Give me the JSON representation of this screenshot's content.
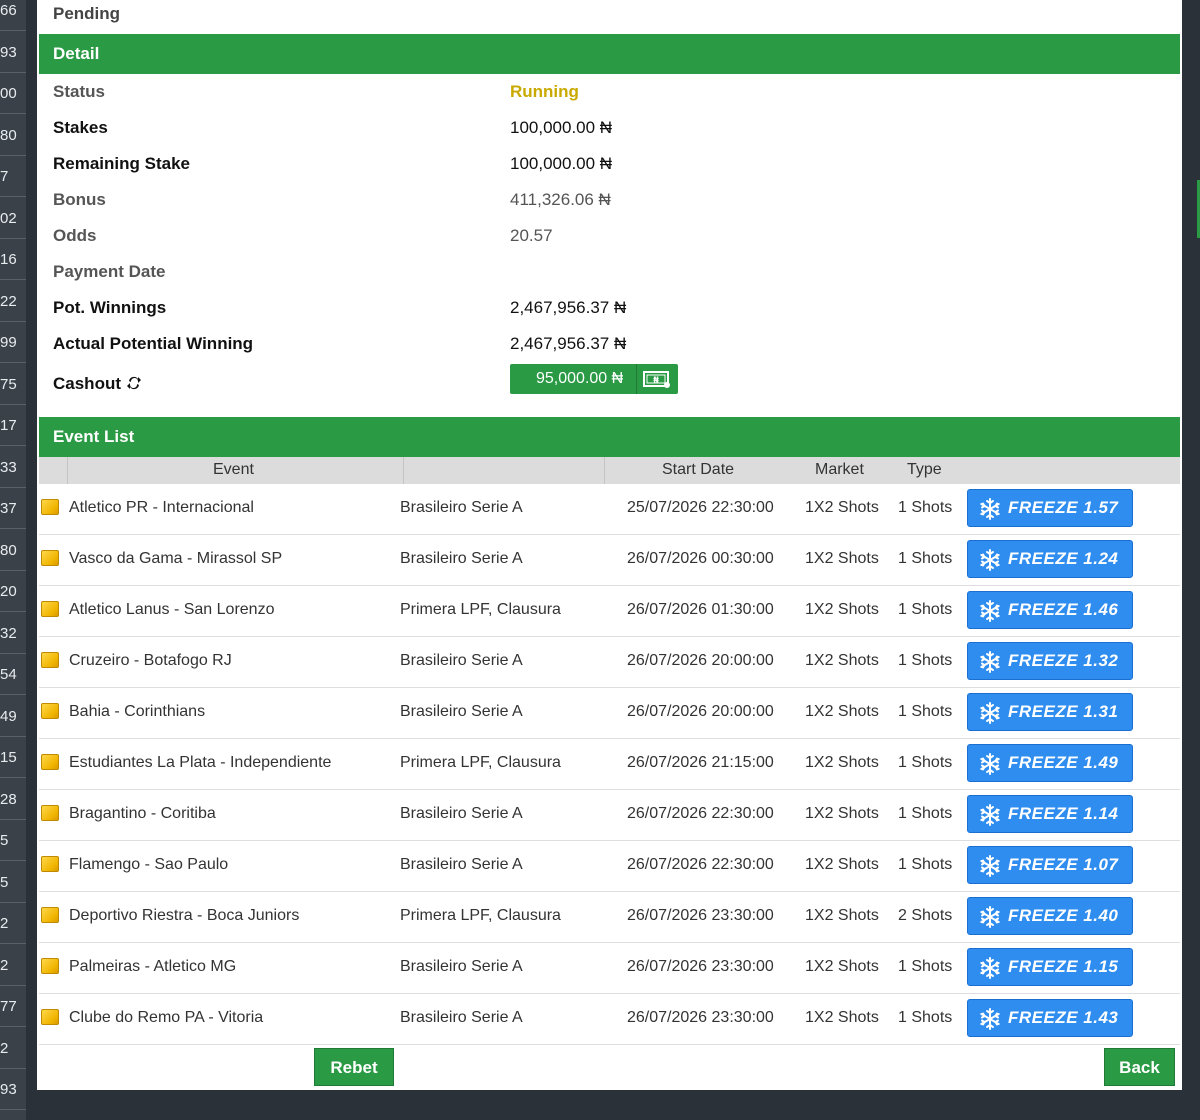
{
  "gutter_numbers": [
    "66",
    "93",
    "00",
    "80",
    "7",
    "02",
    "16",
    "22",
    "99",
    "75",
    "17",
    "33",
    "37",
    "80",
    "20",
    "32",
    "54",
    "49",
    "15",
    "28",
    "5",
    "5",
    "2",
    "2",
    "77",
    "2",
    "93"
  ],
  "status_header": "Pending",
  "detail": {
    "title": "Detail",
    "rows": [
      {
        "label": "Status",
        "value": "Running"
      },
      {
        "label": "Stakes",
        "value": "100,000.00 ₦"
      },
      {
        "label": "Remaining Stake",
        "value": "100,000.00 ₦"
      },
      {
        "label": "Bonus",
        "value": "411,326.06 ₦"
      },
      {
        "label": "Odds",
        "value": "20.57"
      },
      {
        "label": "Payment Date",
        "value": ""
      },
      {
        "label": "Pot. Winnings",
        "value": "2,467,956.37 ₦"
      },
      {
        "label": "Actual Potential Winning",
        "value": "2,467,956.37 ₦"
      }
    ],
    "cashout": {
      "label": "Cashout",
      "amount": "95,000.00 ₦",
      "icon": "cash-note-icon",
      "label_icon": "refresh-icon"
    }
  },
  "event_list": {
    "title": "Event List",
    "columns": {
      "event": "Event",
      "start_date": "Start Date",
      "market": "Market",
      "type": "Type"
    },
    "rows": [
      {
        "event": "Atletico PR - Internacional",
        "league": "Brasileiro Serie A",
        "date": "25/07/2026 22:30:00",
        "market": "1X2 Shots",
        "type": "1 Shots",
        "freeze": "FREEZE 1.57"
      },
      {
        "event": "Vasco da Gama - Mirassol SP",
        "league": "Brasileiro Serie A",
        "date": "26/07/2026 00:30:00",
        "market": "1X2 Shots",
        "type": "1 Shots",
        "freeze": "FREEZE 1.24"
      },
      {
        "event": "Atletico Lanus - San Lorenzo",
        "league": "Primera LPF, Clausura",
        "date": "26/07/2026 01:30:00",
        "market": "1X2 Shots",
        "type": "1 Shots",
        "freeze": "FREEZE 1.46"
      },
      {
        "event": "Cruzeiro - Botafogo RJ",
        "league": "Brasileiro Serie A",
        "date": "26/07/2026 20:00:00",
        "market": "1X2 Shots",
        "type": "1 Shots",
        "freeze": "FREEZE 1.32"
      },
      {
        "event": "Bahia - Corinthians",
        "league": "Brasileiro Serie A",
        "date": "26/07/2026 20:00:00",
        "market": "1X2 Shots",
        "type": "1 Shots",
        "freeze": "FREEZE 1.31"
      },
      {
        "event": "Estudiantes La Plata - Independiente",
        "league": "Primera LPF, Clausura",
        "date": "26/07/2026 21:15:00",
        "market": "1X2 Shots",
        "type": "1 Shots",
        "freeze": "FREEZE 1.49"
      },
      {
        "event": "Bragantino - Coritiba",
        "league": "Brasileiro Serie A",
        "date": "26/07/2026 22:30:00",
        "market": "1X2 Shots",
        "type": "1 Shots",
        "freeze": "FREEZE 1.14"
      },
      {
        "event": "Flamengo - Sao Paulo",
        "league": "Brasileiro Serie A",
        "date": "26/07/2026 22:30:00",
        "market": "1X2 Shots",
        "type": "1 Shots",
        "freeze": "FREEZE 1.07"
      },
      {
        "event": "Deportivo Riestra - Boca Juniors",
        "league": "Primera LPF, Clausura",
        "date": "26/07/2026 23:30:00",
        "market": "1X2 Shots",
        "type": "2 Shots",
        "freeze": "FREEZE 1.40"
      },
      {
        "event": "Palmeiras - Atletico MG",
        "league": "Brasileiro Serie A",
        "date": "26/07/2026 23:30:00",
        "market": "1X2 Shots",
        "type": "1 Shots",
        "freeze": "FREEZE 1.15"
      },
      {
        "event": "Clube do Remo PA - Vitoria",
        "league": "Brasileiro Serie A",
        "date": "26/07/2026 23:30:00",
        "market": "1X2 Shots",
        "type": "1 Shots",
        "freeze": "FREEZE 1.43"
      }
    ]
  },
  "buttons": {
    "rebet": "Rebet",
    "back": "Back"
  },
  "colors": {
    "brand_green": "#2a9a45",
    "running_status": "#c9a900",
    "freeze_blue": "#2f8df0"
  }
}
